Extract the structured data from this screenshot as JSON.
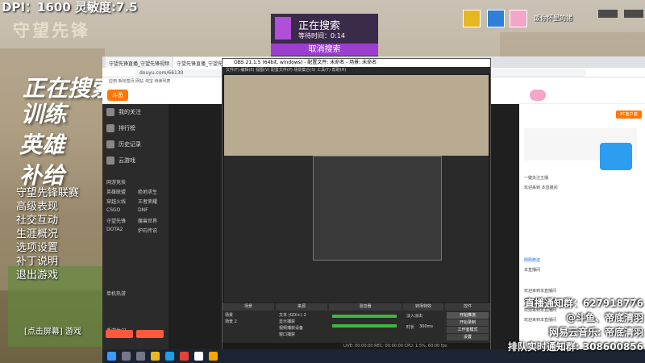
{
  "stream_overlay": {
    "dpi_label": "DPI：1600 灵敏度:7.5",
    "game_logo": "守望先锋",
    "menu_big": [
      "正在搜索",
      "训练",
      "英雄",
      "补给"
    ],
    "menu_small": [
      "守望先锋联赛",
      "高级表现",
      "社交互动",
      "生涯概况",
      "选项设置",
      "补丁说明",
      "退出游戏"
    ],
    "menu_footer": "[点击屏幕] 游戏",
    "search": {
      "title": "正在搜索",
      "wait": "等待时间：0:14",
      "cancel": "取消搜索"
    },
    "user": {
      "name": "饭你怀里的猪",
      "icon1": "mask-icon",
      "icon2": "star-icon"
    },
    "bottom_right": [
      "直播通知群：627918776",
      "@斗鱼、帝底清羽",
      "网易云音乐: 帝底清羽",
      "排队实时通知群: 308600856"
    ]
  },
  "browser": {
    "tabs": [
      "守望先锋直播_守望先锋视频",
      "守望先锋直播_守望先锋视频"
    ],
    "url": "douyu.com/66130",
    "bookmarks": "应用   新标签页   网站  淘宝  待读列表",
    "site_logo": "斗鱼",
    "sidebar_items": [
      "我的关注",
      "排行榜",
      "历史记录",
      "云游戏"
    ],
    "sidebar_section": "网游竞技",
    "sidebar_games": [
      "英雄联盟",
      "绝地求生",
      "穿越火线",
      "王者荣耀",
      "CSGO",
      "DNF",
      "守望先锋",
      "魔兽世界",
      "DOTA2",
      "炉石传说"
    ],
    "sidebar_section2": "单机热游",
    "sidebar_section3": "手游休闲",
    "right_panel": {
      "follow_btn": "PC客户端",
      "chat": [
        "一键关注主播",
        "欢迎来到 本直播间",
        "刚刚赠送",
        "本直播间",
        "欢迎来到本直播间",
        "欢迎来到本直播间",
        "欢迎来到本直播间",
        "欢迎来到本直播间"
      ]
    }
  },
  "obs": {
    "title": "OBS 21.1.5 (64bit, windows) - 配置文件: 未命名 - 场景: 未命名",
    "menu": "文件(F)  编辑(E)  视图(V)  配置文件(P)  场景集合(S)  工具(T)  帮助(H)",
    "dock_titles": [
      "场景",
      "来源",
      "混音器",
      "转场特效",
      "控件"
    ],
    "scenes": [
      "场景",
      "场景 2"
    ],
    "sources": [
      "文本 (GDI+) 2",
      "显示捕获",
      "视频捕获设备",
      "窗口捕获"
    ],
    "controls": [
      "开始推流",
      "开始录制",
      "工作室模式",
      "设置",
      "退出"
    ],
    "transition": "淡入淡出",
    "duration_label": "时长",
    "duration": "300ms",
    "status": "LIVE: 00:00:00   REC: 00:00:00   CPU: 1.5%, 60.00 fps"
  },
  "colors": {
    "accent_purple": "#9c3fd0",
    "douyu_orange": "#ff7700",
    "dark": "#1e1e1e"
  }
}
